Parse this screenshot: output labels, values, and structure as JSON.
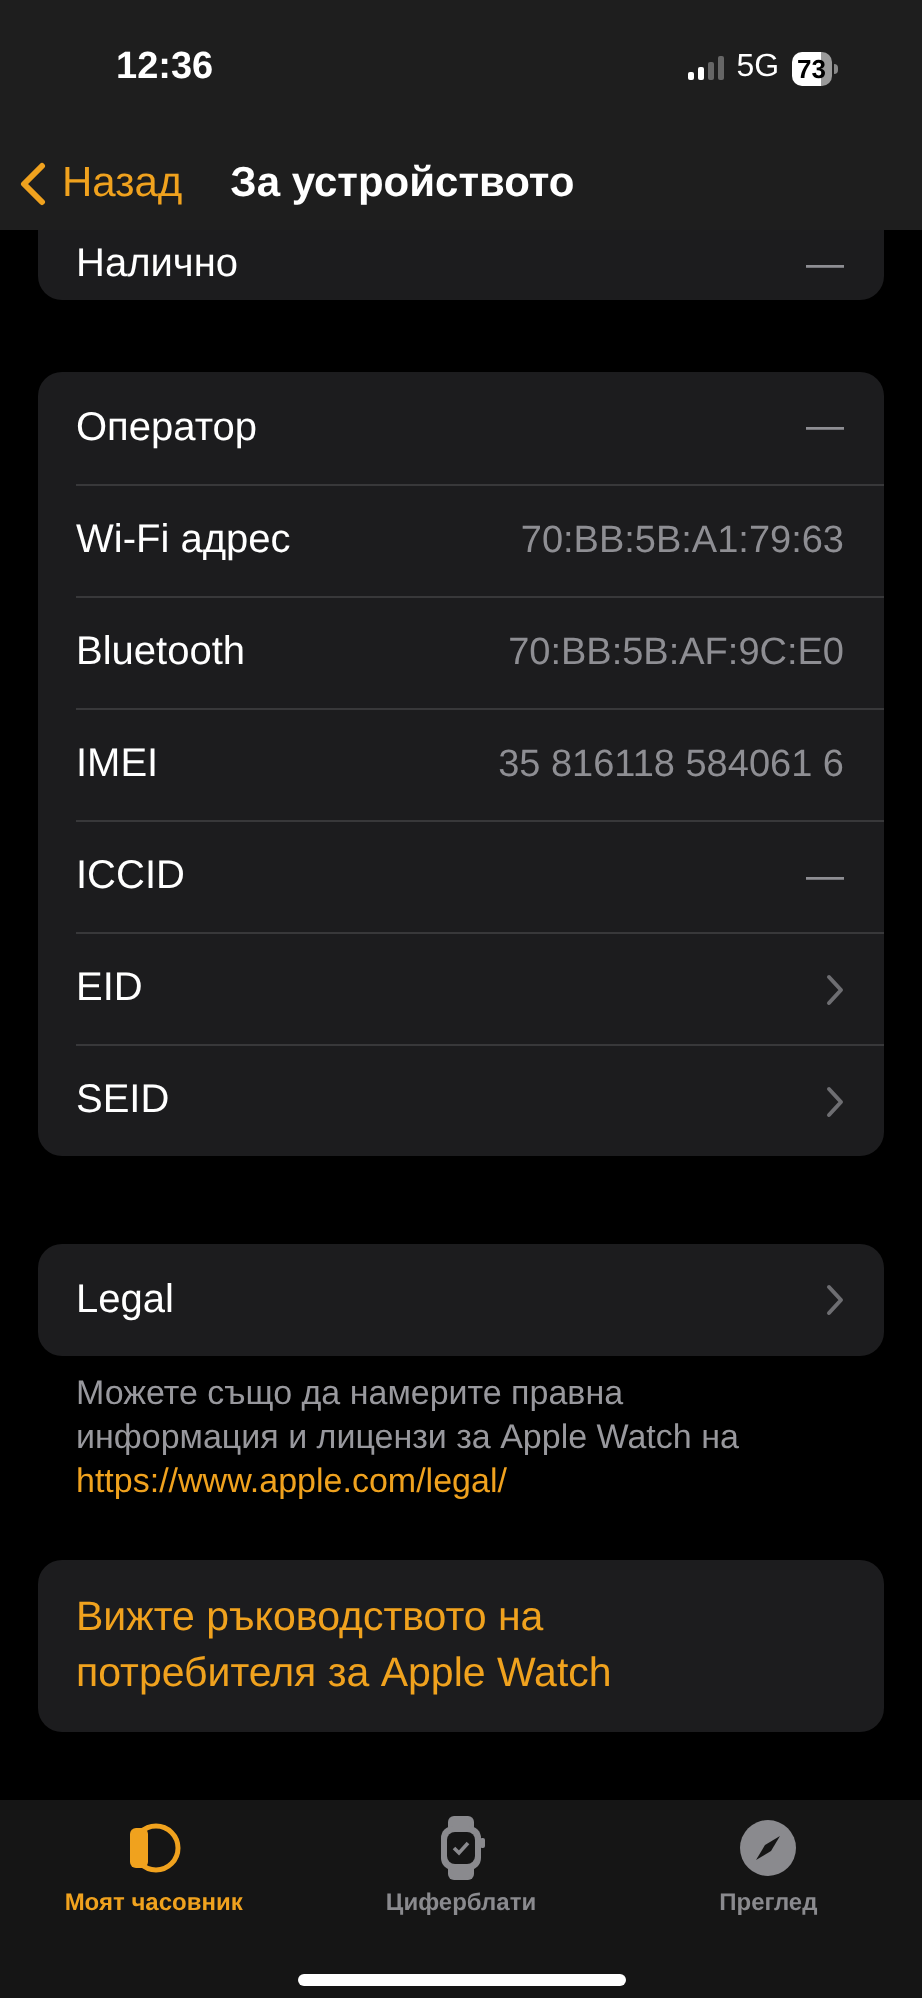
{
  "status_bar": {
    "time": "12:36",
    "network": "5G",
    "battery": "73"
  },
  "nav": {
    "back": "Назад",
    "title": "За устройството"
  },
  "top_group": {
    "rows": [
      {
        "kind": "value",
        "label": "Налично",
        "value": "—"
      }
    ]
  },
  "info_group": {
    "rows": [
      {
        "kind": "value",
        "label": "Оператор",
        "value": "—"
      },
      {
        "kind": "value",
        "label": "Wi-Fi адрес",
        "value": "70:BB:5B:A1:79:63"
      },
      {
        "kind": "value",
        "label": "Bluetooth",
        "value": "70:BB:5B:AF:9C:E0"
      },
      {
        "kind": "value",
        "label": "IMEI",
        "value": "35 816118 584061 6"
      },
      {
        "kind": "value",
        "label": "ICCID",
        "value": "—"
      },
      {
        "kind": "chevron",
        "label": "EID"
      },
      {
        "kind": "chevron",
        "label": "SEID"
      }
    ]
  },
  "legal_group": {
    "rows": [
      {
        "kind": "chevron",
        "label": "Legal"
      }
    ]
  },
  "legal_footer": {
    "text": "Можете също да намерите правна информация и лицензи за Apple Watch на",
    "link": "https://www.apple.com/legal/"
  },
  "guide_button": "Вижте ръководството на потребителя за Apple Watch",
  "tabs": [
    {
      "label": "Моят часовник",
      "selected": true
    },
    {
      "label": "Циферблати",
      "selected": false
    },
    {
      "label": "Преглед",
      "selected": false
    }
  ]
}
